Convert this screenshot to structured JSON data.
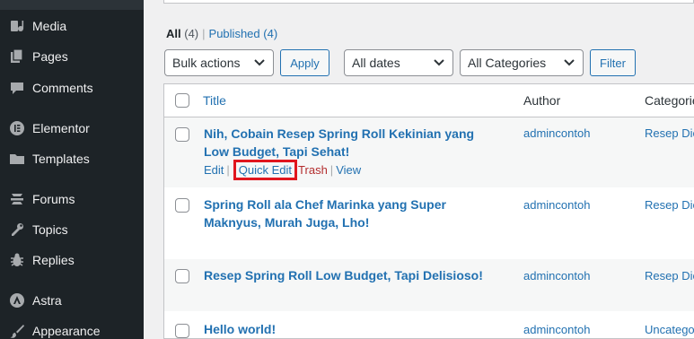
{
  "sidebar": {
    "items": [
      {
        "label": "Media",
        "icon": "media-icon"
      },
      {
        "label": "Pages",
        "icon": "pages-icon"
      },
      {
        "label": "Comments",
        "icon": "comments-icon"
      },
      {
        "label": "Elementor",
        "icon": "elementor-icon"
      },
      {
        "label": "Templates",
        "icon": "folder-icon"
      },
      {
        "label": "Forums",
        "icon": "forums-icon"
      },
      {
        "label": "Topics",
        "icon": "tools-icon"
      },
      {
        "label": "Replies",
        "icon": "bug-icon"
      },
      {
        "label": "Astra",
        "icon": "astra-icon"
      },
      {
        "label": "Appearance",
        "icon": "brush-icon"
      }
    ]
  },
  "filters": {
    "all_label": "All",
    "all_count": "(4)",
    "separator": "|",
    "published_label": "Published",
    "published_count": "(4)"
  },
  "toolbar": {
    "bulk_actions": "Bulk actions",
    "apply": "Apply",
    "dates": "All dates",
    "categories": "All Categories",
    "filter": "Filter"
  },
  "table": {
    "columns": {
      "title": "Title",
      "author": "Author",
      "categories": "Categorie"
    },
    "rows": [
      {
        "title": "Nih, Cobain Resep Spring Roll Kekinian yang Low Budget, Tapi Sehat!",
        "author": "admincontoh",
        "category": "Resep Die",
        "actions": {
          "edit": "Edit",
          "quick_edit": "Quick Edit",
          "trash": "Trash",
          "view": "View",
          "sep": "|"
        }
      },
      {
        "title": "Spring Roll ala Chef Marinka yang Super Maknyus, Murah Juga, Lho!",
        "author": "admincontoh",
        "category": "Resep Die"
      },
      {
        "title": "Resep Spring Roll Low Budget, Tapi Delisioso!",
        "author": "admincontoh",
        "category": "Resep Die"
      },
      {
        "title": "Hello world!",
        "author": "admincontoh",
        "category": "Uncatego"
      }
    ]
  },
  "colors": {
    "sidebar_bg": "#1d2327",
    "link": "#2271b1",
    "trash": "#b32d2e",
    "highlight": "#e0161e"
  }
}
